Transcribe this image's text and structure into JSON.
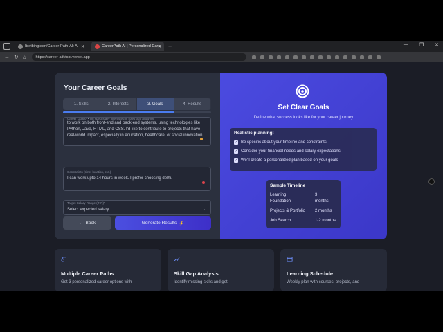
{
  "browser": {
    "tabs": [
      {
        "label": "Itsvibingteen/Career-Path-AI: AI",
        "active": false
      },
      {
        "label": "CareerPath AI | Personalized Care",
        "active": true
      }
    ],
    "new_tab": "+",
    "url": "https://career-advisor.vercel.app",
    "window_controls": [
      "—",
      "❐",
      "✕"
    ]
  },
  "form": {
    "title": "Your Career Goals",
    "steps": [
      "1. Skills",
      "2. Interests",
      "3. Goals",
      "4. Results"
    ],
    "active_step": 2,
    "progress_percent": 75,
    "career_goals": {
      "label": "Career Goals* • I'm specifically interested in roles that allow me",
      "value": "to work on both front-end and back-end systems, using technologies like Python, Java, HTML, and CSS. I'd like to contribute to projects that have real-world impact, especially in education, healthcare, or social innovation."
    },
    "constraints": {
      "label": "Constraints (time, location, etc.)",
      "value": "I can work upto 14 hours in week. I prefer choosing delhi."
    },
    "salary": {
      "label": "Target Salary Range (INR)*",
      "value": "Select expected salary"
    },
    "back_label": "Back",
    "generate_label": "Generate Results"
  },
  "goals_panel": {
    "title": "Set Clear Goals",
    "subtitle": "Define what success looks like for your career journey",
    "planning_title": "Realistic planning:",
    "planning_items": [
      "Be specific about your timeline and constraints",
      "Consider your financial needs and salary expectations",
      "We'll create a personalized plan based on your goals"
    ],
    "timeline_title": "Sample Timeline",
    "timeline": [
      {
        "label_1": "Learning",
        "label_2": "Foundation",
        "value_1": "3",
        "value_2": "months"
      },
      {
        "label": "Projects & Portfolio",
        "value": "2 months"
      },
      {
        "label": "Job Search",
        "value": "1-2 months"
      }
    ]
  },
  "features": [
    {
      "title": "Multiple Career Paths",
      "desc": "Get 3 personalized career options with"
    },
    {
      "title": "Skill Gap Analysis",
      "desc": "Identify missing skills and get"
    },
    {
      "title": "Learning Schedule",
      "desc": "Weekly plan with courses, projects, and"
    }
  ],
  "colors": {
    "accent": "#4a7cf0",
    "panel": "#4b4be0",
    "bg": "#1b1d26"
  }
}
